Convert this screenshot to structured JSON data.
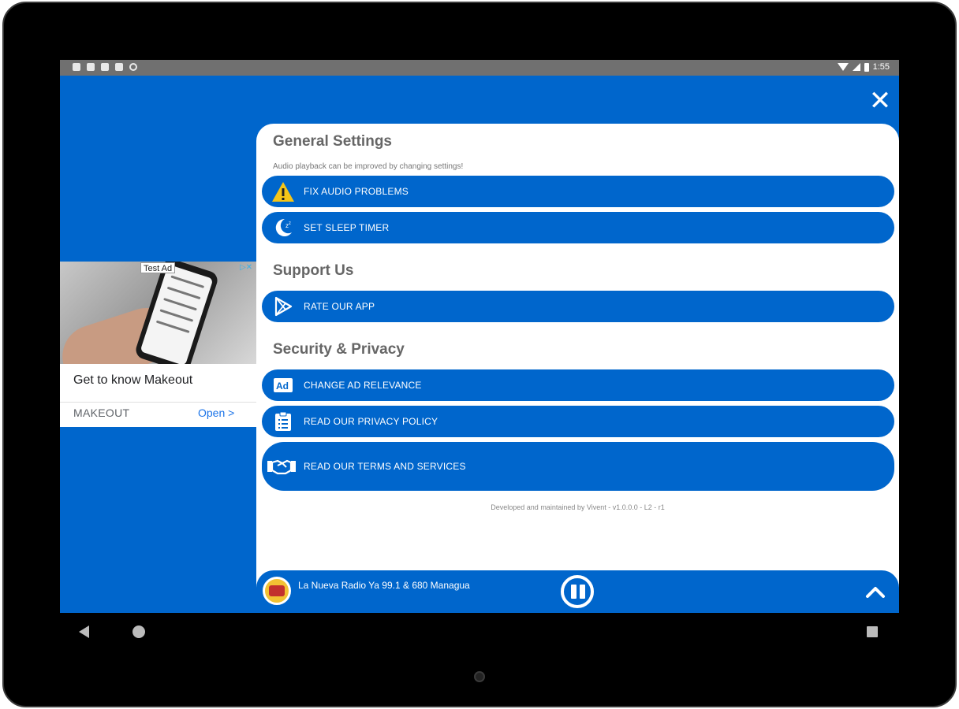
{
  "status_bar": {
    "time": "1:55"
  },
  "ad": {
    "test_label": "Test Ad",
    "choices_icon": "ad-choices-icon",
    "headline": "Get to know Makeout",
    "advertiser": "MAKEOUT",
    "cta": "Open >"
  },
  "settings": {
    "general": {
      "title": "General Settings",
      "subtitle": "Audio playback can be improved by changing settings!",
      "items": [
        {
          "label": "FIX AUDIO PROBLEMS",
          "icon": "warning-icon"
        },
        {
          "label": "SET SLEEP TIMER",
          "icon": "moon-icon"
        }
      ]
    },
    "support": {
      "title": "Support Us",
      "items": [
        {
          "label": "RATE OUR APP",
          "icon": "play-store-icon"
        }
      ]
    },
    "security": {
      "title": "Security & Privacy",
      "items": [
        {
          "label": "CHANGE AD RELEVANCE",
          "icon": "ad-icon"
        },
        {
          "label": "READ OUR PRIVACY POLICY",
          "icon": "clipboard-icon"
        },
        {
          "label": "READ OUR TERMS AND SERVICES",
          "icon": "handshake-icon"
        }
      ]
    },
    "credits": "Developed and maintained by Vivent - v1.0.0.0 - L2 - r1"
  },
  "player": {
    "station_name": "La Nueva Radio Ya 99.1 & 680 Managua",
    "state": "playing"
  },
  "colors": {
    "primary": "#0066cc",
    "panel": "#ffffff",
    "warning": "#f5c518",
    "heading": "#666666"
  }
}
